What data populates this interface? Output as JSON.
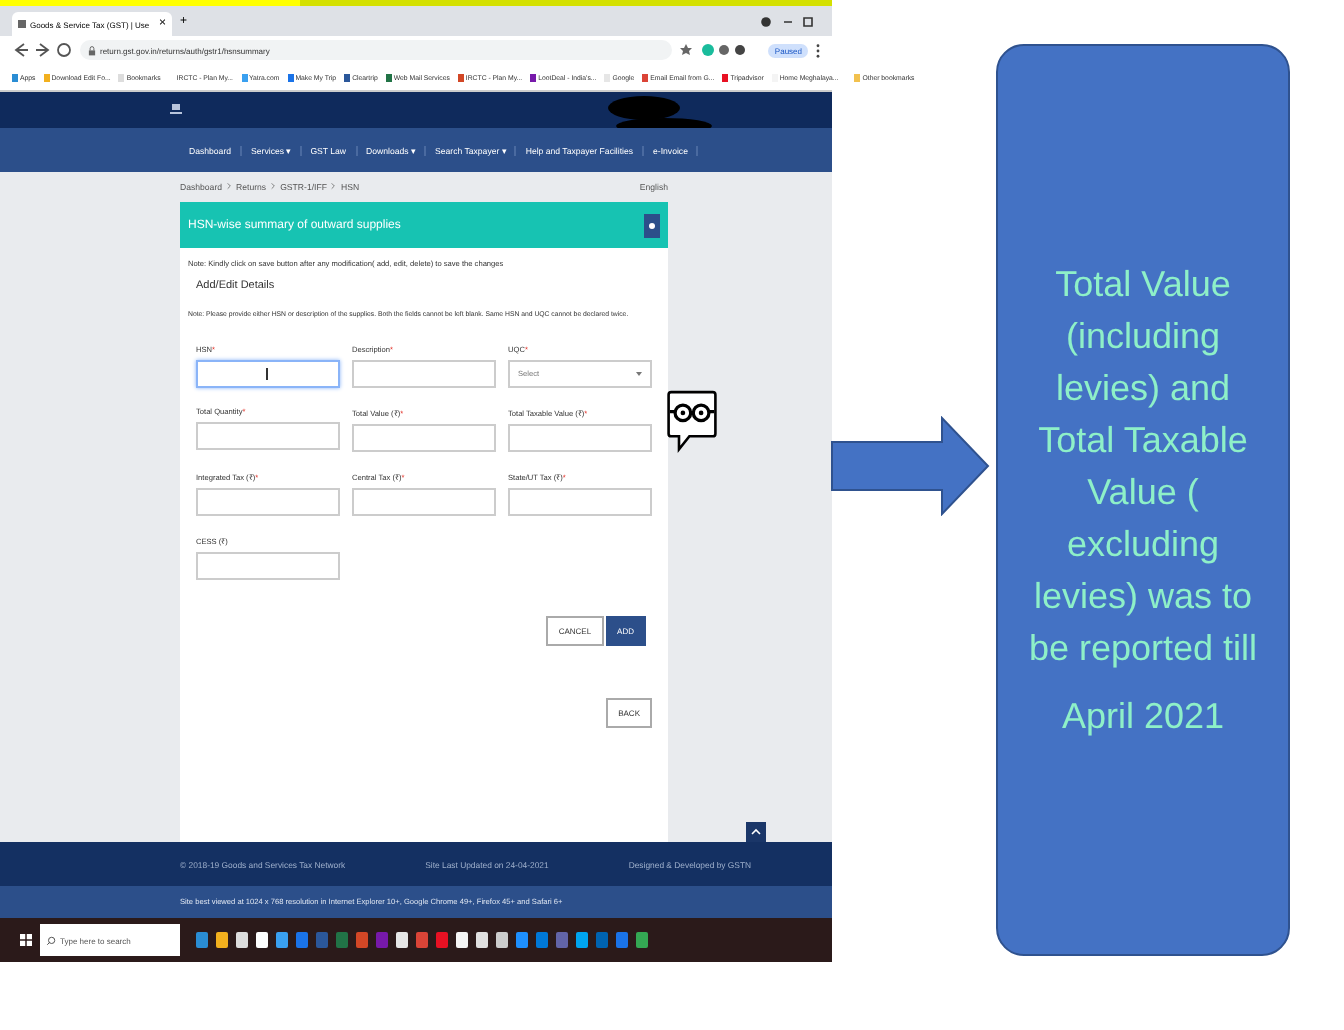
{
  "browser": {
    "tab_title": "Goods & Service Tax (GST) | Use",
    "tab_close": "×",
    "new_tab": "+",
    "url": "return.gst.gov.in/returns/auth/gstr1/hsnsummary",
    "profile": "Paused",
    "bookmarks": [
      "Apps",
      "Download Edit Fo...",
      "Bookmarks",
      "IRCTC - Plan My...",
      "Yatra.com",
      "Make My Trip",
      "Cleartrip",
      "Web Mail Services",
      "IRCTC - Plan My...",
      "LootDeal - India's...",
      "Google",
      "Email Email from G...",
      "Tripadvisor",
      "Home Meghalaya..."
    ],
    "other_bookmarks": "Other bookmarks"
  },
  "nav": [
    "Dashboard",
    "Services ▾",
    "GST Law",
    "Downloads ▾",
    "Search Taxpayer ▾",
    "Help and Taxpayer Facilities",
    "e-Invoice"
  ],
  "breadcrumb": [
    "Dashboard",
    "Returns",
    "GSTR-1/IFF",
    "HSN"
  ],
  "language": "English",
  "panel": {
    "title": "HSN-wise summary of outward supplies",
    "note": "Note: Kindly click on save button after any modification( add, edit, delete) to save the changes",
    "section": "Add/Edit Details",
    "hint": "Note: Please provide either HSN or description of the supplies. Both the fields cannot be left blank. Same HSN and UQC cannot be declared twice.",
    "fields": [
      [
        {
          "label": "HSN",
          "mark": "*",
          "kind": "input",
          "focused": true
        },
        {
          "label": "Description",
          "mark": "*",
          "kind": "input",
          "focused": false
        },
        {
          "label": "UQC",
          "mark": "*",
          "kind": "select",
          "placeholder": "Select",
          "focused": false
        }
      ],
      [
        {
          "label": "Total Quantity",
          "mark": "*",
          "kind": "input",
          "focused": false
        },
        {
          "label": "Total Value (₹)",
          "mark": "*",
          "kind": "input",
          "focused": false
        },
        {
          "label": "Total Taxable Value (₹)",
          "mark": "*",
          "kind": "input",
          "focused": false
        }
      ],
      [
        {
          "label": "Integrated Tax (₹)",
          "mark": "*",
          "kind": "input",
          "focused": false
        },
        {
          "label": "Central Tax (₹)",
          "mark": "*",
          "kind": "input",
          "focused": false
        },
        {
          "label": "State/UT Tax (₹)",
          "mark": "*",
          "kind": "input",
          "focused": false
        }
      ],
      [
        {
          "label": "CESS (₹)",
          "kind": "input",
          "focused": false
        }
      ]
    ],
    "buttons": [
      {
        "label": "CANCEL",
        "primary": false
      },
      {
        "label": "ADD",
        "primary": true
      }
    ],
    "back": "BACK"
  },
  "footer": {
    "copyright": "© 2018-19 Goods and Services Tax Network",
    "updated": "Site Last Updated on 24-04-2021",
    "designed": "Designed & Developed by GSTN",
    "best_viewed": "Site best viewed at 1024 x 768 resolution in Internet Explorer 10+, Google Chrome 49+, Firefox 45+ and Safari 6+"
  },
  "taskbar": {
    "search_placeholder": "Type here to search"
  },
  "callout": {
    "text": "Total Value (including levies) and Total Taxable Value ( excluding levies) was to be reported till",
    "date": "April 2021"
  }
}
